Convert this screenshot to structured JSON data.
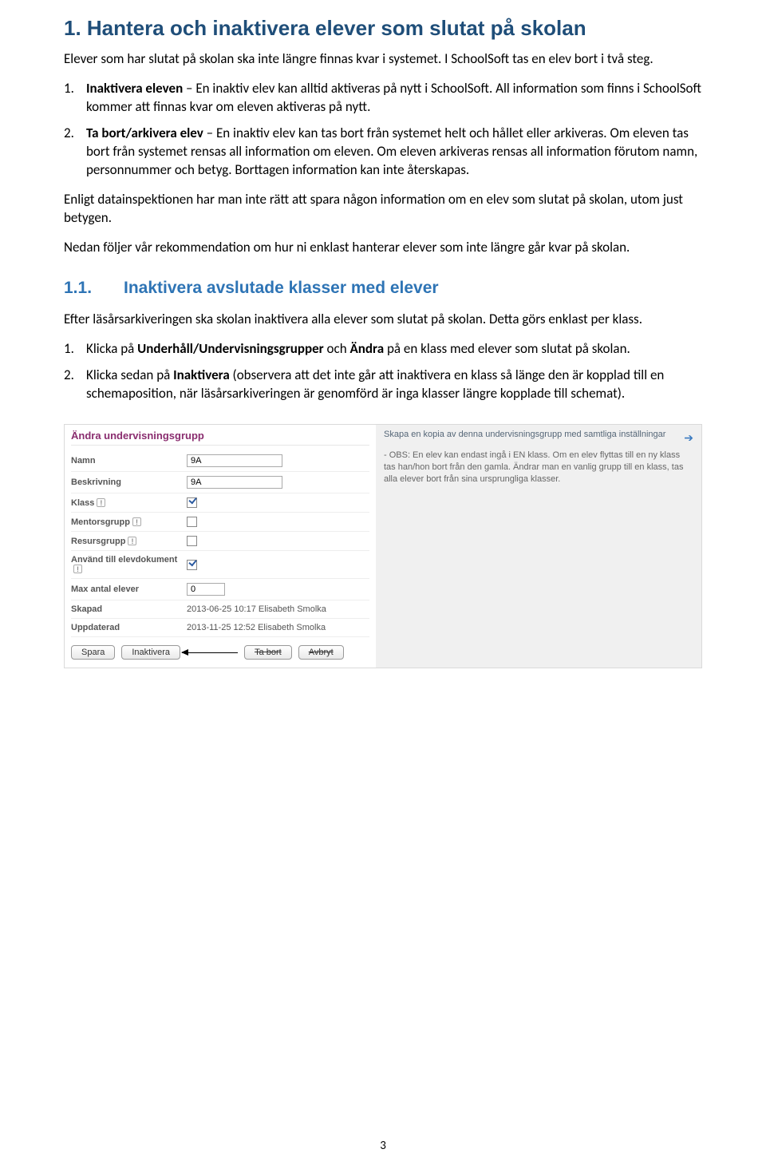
{
  "h1": "1. Hantera och inaktivera elever som slutat på skolan",
  "intro": "Elever som har slutat på skolan ska inte längre finnas kvar i systemet. I SchoolSoft tas en elev bort i två steg.",
  "list1": [
    {
      "num": "1.",
      "lead": "Inaktivera eleven",
      "rest": " – En inaktiv elev kan alltid aktiveras på nytt i SchoolSoft. All information som finns i SchoolSoft kommer att finnas kvar om eleven aktiveras på nytt."
    },
    {
      "num": "2.",
      "lead": "Ta bort/arkivera elev",
      "rest": " – En inaktiv elev kan tas bort från systemet helt och hållet eller arkiveras. Om eleven tas bort från systemet rensas all information om eleven. Om eleven arkiveras rensas all information förutom namn, personnummer och betyg. Borttagen information kan inte återskapas."
    }
  ],
  "p3": "Enligt datainspektionen har man inte rätt att spara någon information om en elev som slutat på skolan, utom just betygen.",
  "p4": "Nedan följer vår rekommendation om hur ni enklast hanterar elever som inte längre går kvar på skolan.",
  "h2_num": "1.1.",
  "h2": "Inaktivera avslutade klasser med elever",
  "p5": "Efter läsårsarkiveringen ska skolan inaktivera alla elever som slutat på skolan. Detta görs enklast per klass.",
  "list2": [
    {
      "num": "1.",
      "pre": "Klicka på ",
      "b1": "Underhåll/Undervisningsgrupper",
      "mid": " och ",
      "b2": "Ändra",
      "post": " på en klass med elever som slutat på skolan."
    },
    {
      "num": "2.",
      "pre": "Klicka sedan på ",
      "b1": "Inaktivera",
      "post": " (observera att det inte går att inaktivera en klass så länge den är kopplad till en schemaposition, när läsårsarkiveringen är genomförd är inga klasser längre kopplade till schemat)."
    }
  ],
  "shot": {
    "title": "Ändra undervisningsgrupp",
    "rows": {
      "namn_label": "Namn",
      "namn_value": "9A",
      "beskr_label": "Beskrivning",
      "beskr_value": "9A",
      "klass_label": "Klass",
      "klass_checked": true,
      "mentor_label": "Mentorsgrupp",
      "mentor_checked": false,
      "resurs_label": "Resursgrupp",
      "resurs_checked": false,
      "elevdok_label": "Använd till elevdokument",
      "elevdok_checked": true,
      "max_label": "Max antal elever",
      "max_value": "0",
      "skapad_label": "Skapad",
      "skapad_value": "2013-06-25 10:17 Elisabeth Smolka",
      "uppd_label": "Uppdaterad",
      "uppd_value": "2013-11-25 12:52 Elisabeth Smolka"
    },
    "buttons": {
      "spara": "Spara",
      "inaktivera": "Inaktivera",
      "tabort": "Ta bort",
      "avbryt": "Avbryt"
    },
    "right_link": "Skapa en kopia av denna undervisningsgrupp med samtliga inställningar",
    "right_note": "- OBS: En elev kan endast ingå i EN klass. Om en elev flyttas till en ny klass tas han/hon bort från den gamla. Ändrar man en vanlig grupp till en klass, tas alla elever bort från sina ursprungliga klasser."
  },
  "page_number": "3"
}
